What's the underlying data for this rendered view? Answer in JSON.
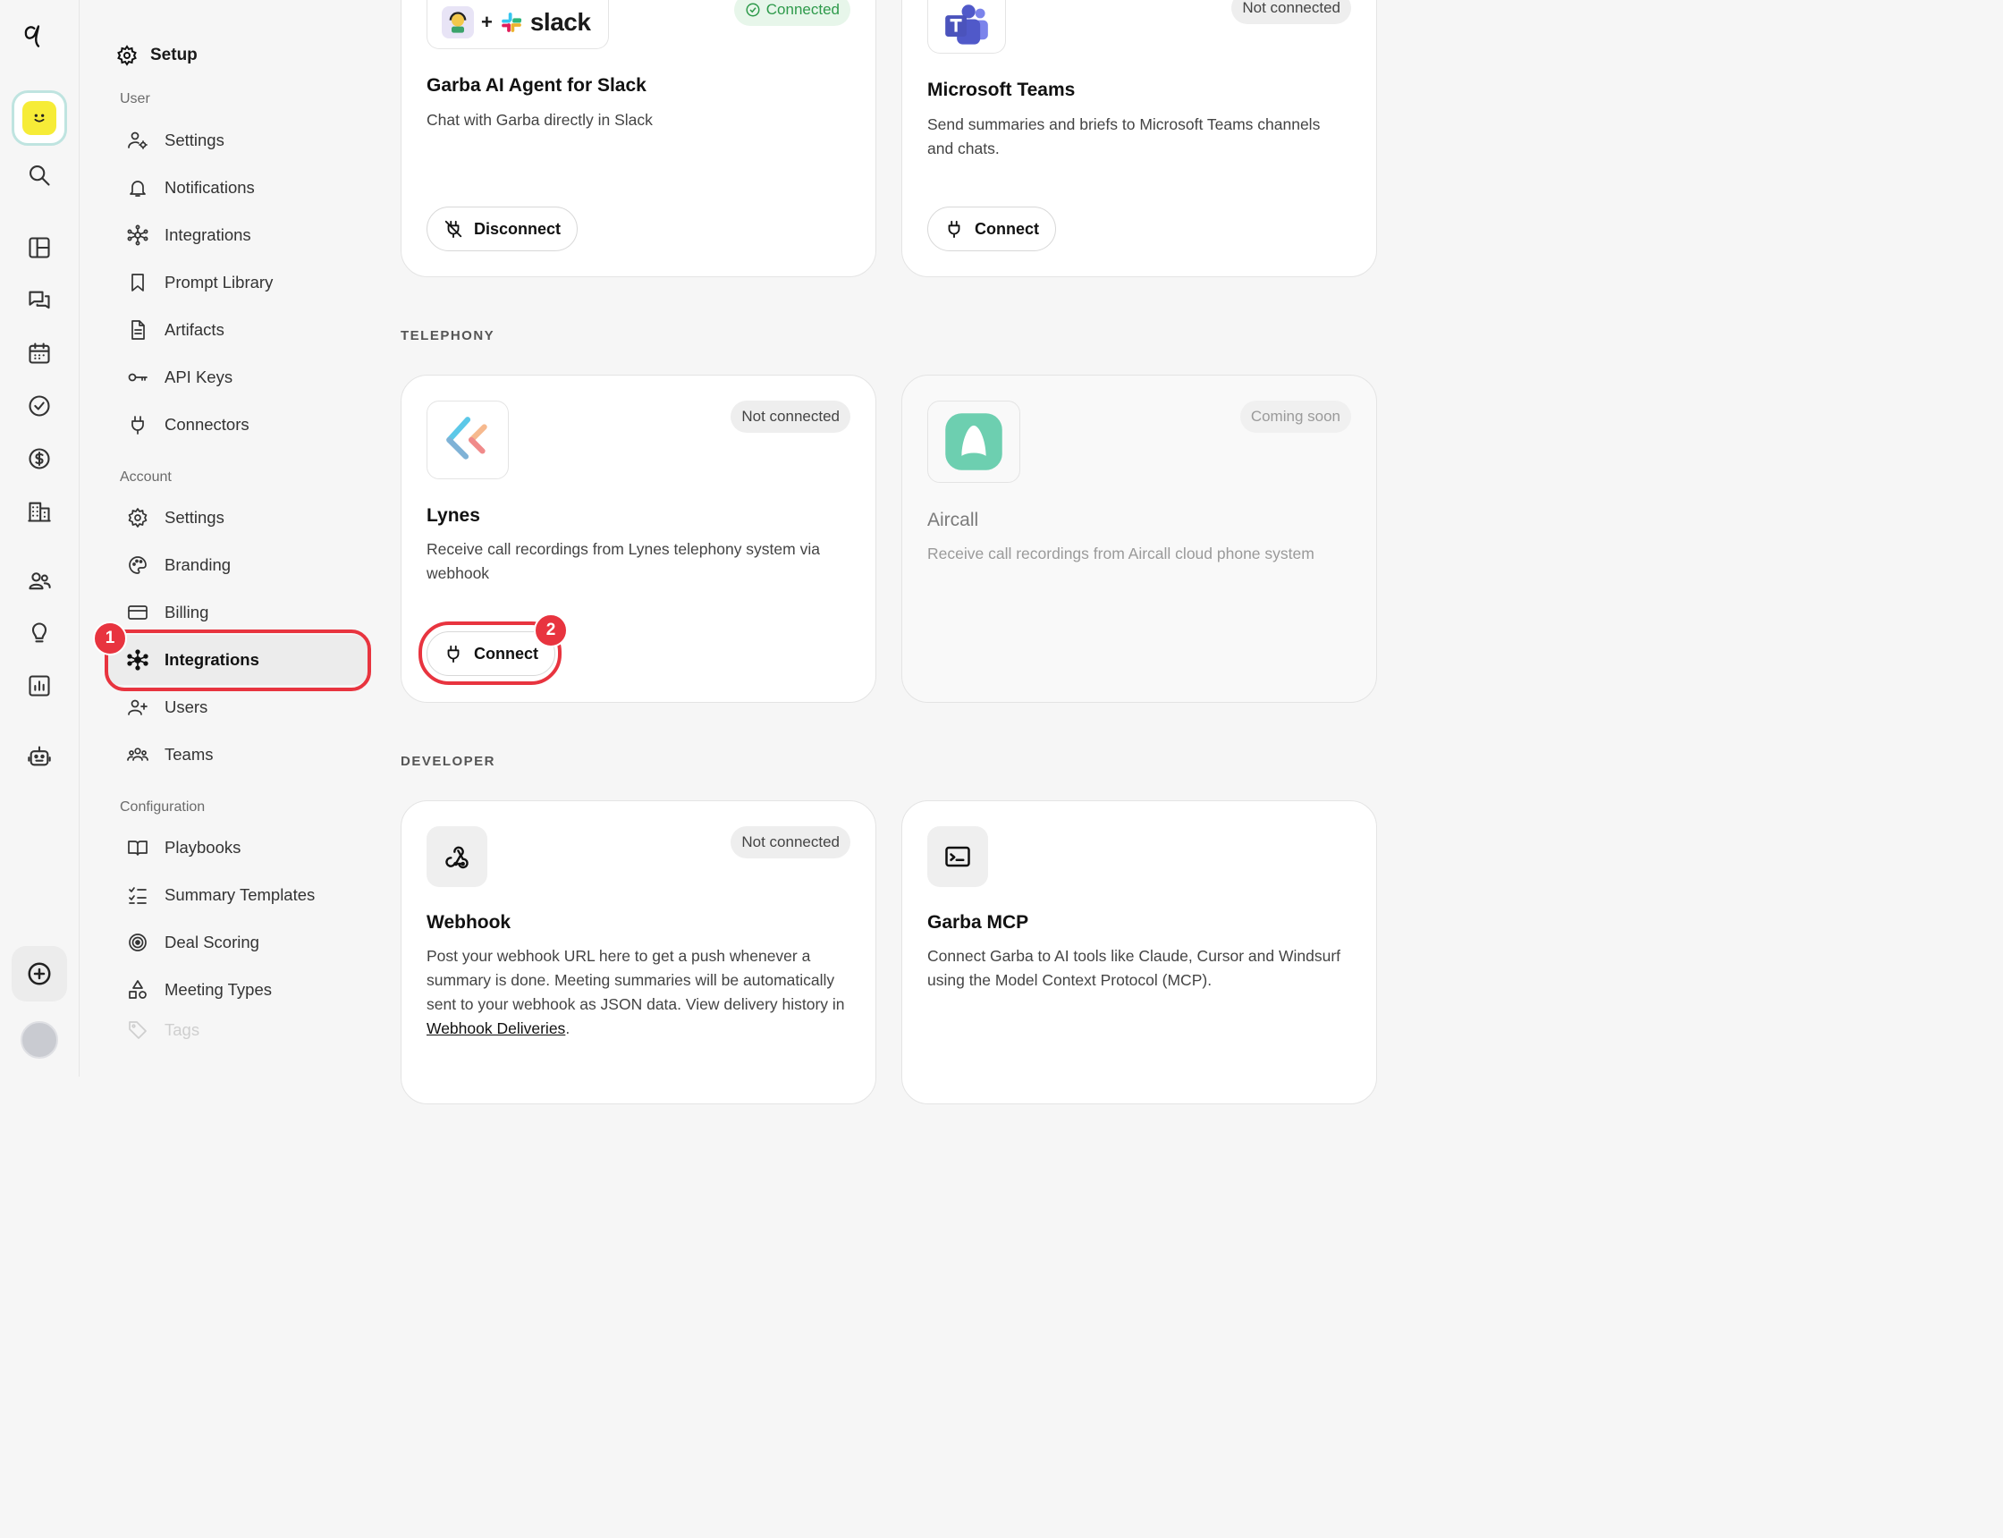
{
  "sidebar": {
    "title": "Setup",
    "sections": [
      {
        "label": "User",
        "items": [
          {
            "label": "Settings",
            "icon": "user-gear-icon"
          },
          {
            "label": "Notifications",
            "icon": "bell-icon"
          },
          {
            "label": "Integrations",
            "icon": "hub-icon"
          },
          {
            "label": "Prompt Library",
            "icon": "bookmark-icon"
          },
          {
            "label": "Artifacts",
            "icon": "document-icon"
          },
          {
            "label": "API Keys",
            "icon": "key-icon"
          },
          {
            "label": "Connectors",
            "icon": "plug-icon"
          }
        ]
      },
      {
        "label": "Account",
        "items": [
          {
            "label": "Settings",
            "icon": "gear-icon"
          },
          {
            "label": "Branding",
            "icon": "palette-icon"
          },
          {
            "label": "Billing",
            "icon": "credit-card-icon"
          },
          {
            "label": "Integrations",
            "icon": "hub-icon",
            "active": true
          },
          {
            "label": "Users",
            "icon": "user-add-icon"
          },
          {
            "label": "Teams",
            "icon": "team-icon"
          }
        ]
      },
      {
        "label": "Configuration",
        "items": [
          {
            "label": "Playbooks",
            "icon": "book-icon"
          },
          {
            "label": "Summary Templates",
            "icon": "checklist-icon"
          },
          {
            "label": "Deal Scoring",
            "icon": "target-icon"
          },
          {
            "label": "Meeting Types",
            "icon": "shapes-icon"
          },
          {
            "label": "Tags",
            "icon": "tag-icon"
          }
        ]
      }
    ]
  },
  "annotations": {
    "step1": "1",
    "step2": "2"
  },
  "cards": {
    "slack": {
      "logo_text": "slack",
      "name": "Garba AI Agent for Slack",
      "desc": "Chat with Garba directly in Slack",
      "status": "Connected",
      "button": "Disconnect"
    },
    "teams": {
      "name": "Microsoft Teams",
      "desc": "Send summaries and briefs to Microsoft Teams channels and chats.",
      "status": "Not connected",
      "button": "Connect"
    },
    "lynes": {
      "name": "Lynes",
      "desc": "Receive call recordings from Lynes telephony system via webhook",
      "status": "Not connected",
      "button": "Connect"
    },
    "aircall": {
      "name": "Aircall",
      "desc": "Receive call recordings from Aircall cloud phone system",
      "status": "Coming soon"
    },
    "webhook": {
      "name": "Webhook",
      "desc_pre": "Post your webhook URL here to get a push whenever a summary is done. Meeting summaries will be automatically sent to your webhook as JSON data. View delivery history in ",
      "desc_link": "Webhook Deliveries",
      "desc_post": ".",
      "status": "Not connected"
    },
    "mcp": {
      "name": "Garba MCP",
      "desc": "Connect Garba to AI tools like Claude, Cursor and Windsurf using the Model Context Protocol (MCP)."
    }
  },
  "headings": {
    "telephony": "TELEPHONY",
    "developer": "DEVELOPER"
  },
  "colors": {
    "accent_red": "#e8343f",
    "connected_green": "#2e9a4b",
    "workspace_yellow": "#f6ec37",
    "aircall_green": "#6dcfb0"
  }
}
